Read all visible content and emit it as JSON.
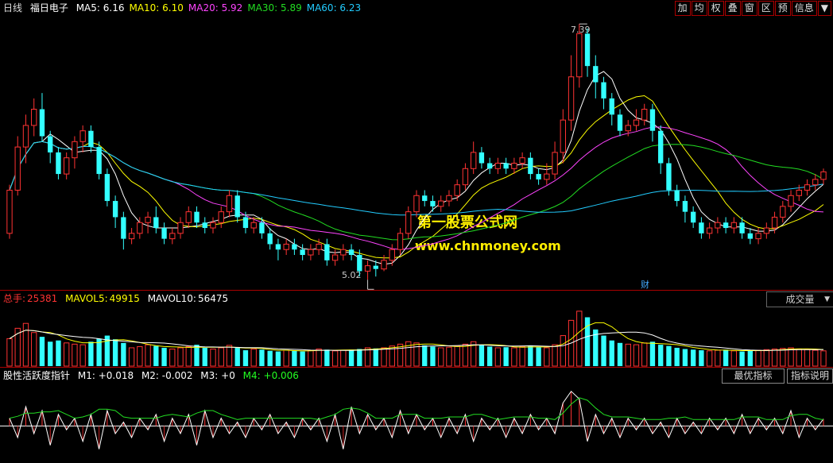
{
  "header": {
    "period": "日线",
    "stock_name": "福日电子",
    "ma": [
      {
        "label": "MA5: 6.16",
        "color": "#ffffff"
      },
      {
        "label": "MA10: 6.10",
        "color": "#ffff00"
      },
      {
        "label": "MA20: 5.92",
        "color": "#ff44ff"
      },
      {
        "label": "MA30: 5.89",
        "color": "#22dd22"
      },
      {
        "label": "MA60: 6.23",
        "color": "#22ccff"
      }
    ]
  },
  "toolbar": [
    "加",
    "均",
    "权",
    "叠",
    "窗",
    "区",
    "预",
    "信息",
    "▼"
  ],
  "price_annotations": {
    "high": "7.39",
    "low": "5.02"
  },
  "watermark": {
    "line1": "第一股票公式网",
    "line2": "www.chnmoney.com"
  },
  "finance_marker": "财",
  "volume_header": {
    "total_label": "总手:",
    "total_value": "25381",
    "mavol5_label": "MAVOL5:",
    "mavol5_value": "49915",
    "mavol10_label": "MAVOL10:",
    "mavol10_value": "56475",
    "selector": "成交量"
  },
  "indicator_header": {
    "name": "股性活跃度指针",
    "m1": "M1: +0.018",
    "m2": "M2: -0.002",
    "m3": "M3: +0",
    "m4": "M4: +0.006",
    "best_button": "最优指标",
    "help_button": "指标说明"
  },
  "colors": {
    "up": "#ff3333",
    "down": "#33ffff",
    "separator": "#aa0000"
  },
  "chart_data": {
    "type": "candlestick",
    "ylim": [
      5.0,
      7.45
    ],
    "candles": [
      [
        5.45,
        5.85,
        5.4,
        5.9
      ],
      [
        5.85,
        6.25,
        5.8,
        6.35
      ],
      [
        6.25,
        6.45,
        6.1,
        6.55
      ],
      [
        6.45,
        6.6,
        6.35,
        6.7
      ],
      [
        6.6,
        6.35,
        6.3,
        6.75
      ],
      [
        6.35,
        6.2,
        6.1,
        6.4
      ],
      [
        6.2,
        6.0,
        5.95,
        6.25
      ],
      [
        6.0,
        6.15,
        5.95,
        6.2
      ],
      [
        6.15,
        6.3,
        6.05,
        6.35
      ],
      [
        6.3,
        6.4,
        6.2,
        6.45
      ],
      [
        6.4,
        6.25,
        6.2,
        6.45
      ],
      [
        6.25,
        6.0,
        5.95,
        6.3
      ],
      [
        6.0,
        5.75,
        5.7,
        6.05
      ],
      [
        5.75,
        5.6,
        5.5,
        5.8
      ],
      [
        5.6,
        5.4,
        5.3,
        5.65
      ],
      [
        5.4,
        5.45,
        5.35,
        5.5
      ],
      [
        5.45,
        5.55,
        5.4,
        5.6
      ],
      [
        5.55,
        5.6,
        5.45,
        5.65
      ],
      [
        5.6,
        5.5,
        5.45,
        5.7
      ],
      [
        5.5,
        5.4,
        5.35,
        5.55
      ],
      [
        5.4,
        5.45,
        5.35,
        5.5
      ],
      [
        5.45,
        5.55,
        5.4,
        5.6
      ],
      [
        5.55,
        5.65,
        5.5,
        5.7
      ],
      [
        5.65,
        5.55,
        5.5,
        5.7
      ],
      [
        5.55,
        5.5,
        5.45,
        5.6
      ],
      [
        5.5,
        5.55,
        5.45,
        5.6
      ],
      [
        5.55,
        5.65,
        5.5,
        5.7
      ],
      [
        5.65,
        5.8,
        5.6,
        5.85
      ],
      [
        5.8,
        5.6,
        5.55,
        5.85
      ],
      [
        5.6,
        5.5,
        5.45,
        5.65
      ],
      [
        5.5,
        5.55,
        5.45,
        5.6
      ],
      [
        5.55,
        5.45,
        5.4,
        5.6
      ],
      [
        5.45,
        5.35,
        5.3,
        5.5
      ],
      [
        5.35,
        5.3,
        5.2,
        5.4
      ],
      [
        5.3,
        5.35,
        5.25,
        5.4
      ],
      [
        5.35,
        5.3,
        5.25,
        5.4
      ],
      [
        5.3,
        5.25,
        5.2,
        5.35
      ],
      [
        5.25,
        5.3,
        5.2,
        5.35
      ],
      [
        5.3,
        5.35,
        5.25,
        5.4
      ],
      [
        5.35,
        5.2,
        5.15,
        5.4
      ],
      [
        5.2,
        5.25,
        5.15,
        5.3
      ],
      [
        5.25,
        5.3,
        5.2,
        5.35
      ],
      [
        5.3,
        5.25,
        5.2,
        5.35
      ],
      [
        5.25,
        5.1,
        5.05,
        5.3
      ],
      [
        5.1,
        5.15,
        5.02,
        5.2
      ],
      [
        5.15,
        5.12,
        5.05,
        5.2
      ],
      [
        5.12,
        5.2,
        5.1,
        5.25
      ],
      [
        5.2,
        5.3,
        5.15,
        5.35
      ],
      [
        5.3,
        5.45,
        5.25,
        5.5
      ],
      [
        5.45,
        5.65,
        5.4,
        5.7
      ],
      [
        5.65,
        5.8,
        5.6,
        5.85
      ],
      [
        5.8,
        5.75,
        5.7,
        5.85
      ],
      [
        5.75,
        5.7,
        5.65,
        5.8
      ],
      [
        5.7,
        5.75,
        5.65,
        5.8
      ],
      [
        5.75,
        5.8,
        5.7,
        5.85
      ],
      [
        5.8,
        5.9,
        5.75,
        5.95
      ],
      [
        5.9,
        6.05,
        5.85,
        6.1
      ],
      [
        6.05,
        6.2,
        6.0,
        6.3
      ],
      [
        6.2,
        6.1,
        6.05,
        6.25
      ],
      [
        6.1,
        6.05,
        6.0,
        6.15
      ],
      [
        6.05,
        6.1,
        6.0,
        6.15
      ],
      [
        6.1,
        6.05,
        6.0,
        6.15
      ],
      [
        6.05,
        6.1,
        6.0,
        6.15
      ],
      [
        6.1,
        6.15,
        6.05,
        6.2
      ],
      [
        6.15,
        6.0,
        5.95,
        6.2
      ],
      [
        6.0,
        5.95,
        5.9,
        6.05
      ],
      [
        5.95,
        6.0,
        5.9,
        6.1
      ],
      [
        6.0,
        6.2,
        5.95,
        6.3
      ],
      [
        6.2,
        6.5,
        6.1,
        6.6
      ],
      [
        6.5,
        6.9,
        6.4,
        7.1
      ],
      [
        6.9,
        7.3,
        6.8,
        7.39
      ],
      [
        7.3,
        7.0,
        6.9,
        7.35
      ],
      [
        7.0,
        6.85,
        6.7,
        7.1
      ],
      [
        6.85,
        6.7,
        6.6,
        6.9
      ],
      [
        6.7,
        6.55,
        6.45,
        6.75
      ],
      [
        6.55,
        6.4,
        6.35,
        6.6
      ],
      [
        6.4,
        6.45,
        6.35,
        6.5
      ],
      [
        6.45,
        6.5,
        6.4,
        6.6
      ],
      [
        6.5,
        6.6,
        6.45,
        6.65
      ],
      [
        6.6,
        6.4,
        6.3,
        6.65
      ],
      [
        6.4,
        6.1,
        6.0,
        6.45
      ],
      [
        6.1,
        5.85,
        5.8,
        6.15
      ],
      [
        5.85,
        5.75,
        5.7,
        5.9
      ],
      [
        5.75,
        5.65,
        5.55,
        5.8
      ],
      [
        5.65,
        5.55,
        5.5,
        5.7
      ],
      [
        5.55,
        5.45,
        5.4,
        5.6
      ],
      [
        5.45,
        5.5,
        5.4,
        5.55
      ],
      [
        5.5,
        5.55,
        5.45,
        5.6
      ],
      [
        5.55,
        5.5,
        5.45,
        5.6
      ],
      [
        5.5,
        5.55,
        5.45,
        5.6
      ],
      [
        5.55,
        5.45,
        5.4,
        5.6
      ],
      [
        5.45,
        5.4,
        5.35,
        5.5
      ],
      [
        5.4,
        5.45,
        5.35,
        5.5
      ],
      [
        5.45,
        5.5,
        5.4,
        5.55
      ],
      [
        5.5,
        5.6,
        5.45,
        5.65
      ],
      [
        5.6,
        5.7,
        5.55,
        5.75
      ],
      [
        5.7,
        5.8,
        5.65,
        5.85
      ],
      [
        5.8,
        5.85,
        5.75,
        5.9
      ],
      [
        5.85,
        5.9,
        5.8,
        5.95
      ],
      [
        5.9,
        5.95,
        5.85,
        6.0
      ],
      [
        5.95,
        6.02,
        5.9,
        6.05
      ]
    ],
    "volume": [
      45,
      62,
      70,
      55,
      48,
      40,
      42,
      38,
      36,
      35,
      40,
      45,
      50,
      44,
      38,
      30,
      32,
      35,
      33,
      30,
      28,
      30,
      32,
      35,
      30,
      28,
      30,
      34,
      30,
      26,
      28,
      27,
      25,
      24,
      26,
      25,
      24,
      26,
      28,
      27,
      25,
      26,
      27,
      28,
      30,
      29,
      30,
      33,
      36,
      40,
      38,
      34,
      32,
      30,
      31,
      33,
      36,
      40,
      35,
      32,
      30,
      31,
      30,
      32,
      34,
      31,
      30,
      35,
      50,
      75,
      90,
      80,
      60,
      50,
      42,
      38,
      36,
      35,
      38,
      40,
      35,
      33,
      30,
      28,
      27,
      26,
      25,
      26,
      27,
      25,
      24,
      25,
      26,
      27,
      28,
      29,
      30,
      28,
      27,
      26,
      25
    ],
    "vol_ylim": [
      0,
      95
    ],
    "osc": [
      0.02,
      -0.03,
      0.05,
      -0.02,
      0.04,
      -0.05,
      0.03,
      -0.01,
      0.02,
      -0.04,
      0.03,
      -0.06,
      0.04,
      -0.02,
      0.01,
      -0.03,
      0.02,
      -0.01,
      0.03,
      -0.04,
      0.02,
      -0.02,
      0.03,
      -0.05,
      0.04,
      -0.03,
      0.02,
      -0.02,
      0.01,
      -0.03,
      0.02,
      -0.01,
      0.03,
      -0.02,
      0.01,
      -0.03,
      0.02,
      -0.01,
      0.02,
      -0.04,
      0.03,
      -0.06,
      0.05,
      -0.02,
      0.03,
      -0.01,
      0.02,
      -0.03,
      0.04,
      -0.02,
      0.03,
      -0.01,
      0.02,
      -0.03,
      0.02,
      -0.02,
      0.03,
      -0.04,
      0.02,
      -0.01,
      0.02,
      -0.03,
      0.02,
      -0.02,
      0.03,
      -0.01,
      0.02,
      -0.02,
      0.06,
      0.09,
      0.07,
      -0.04,
      0.03,
      -0.02,
      0.02,
      -0.03,
      0.02,
      -0.01,
      0.02,
      -0.02,
      0.01,
      -0.03,
      0.02,
      -0.02,
      0.01,
      -0.02,
      0.02,
      -0.01,
      0.02,
      -0.02,
      0.03,
      -0.02,
      0.02,
      -0.01,
      0.02,
      -0.02,
      0.04,
      -0.03,
      0.02,
      -0.01,
      0.018
    ],
    "osc_ylim": [
      -0.09,
      0.11
    ]
  }
}
